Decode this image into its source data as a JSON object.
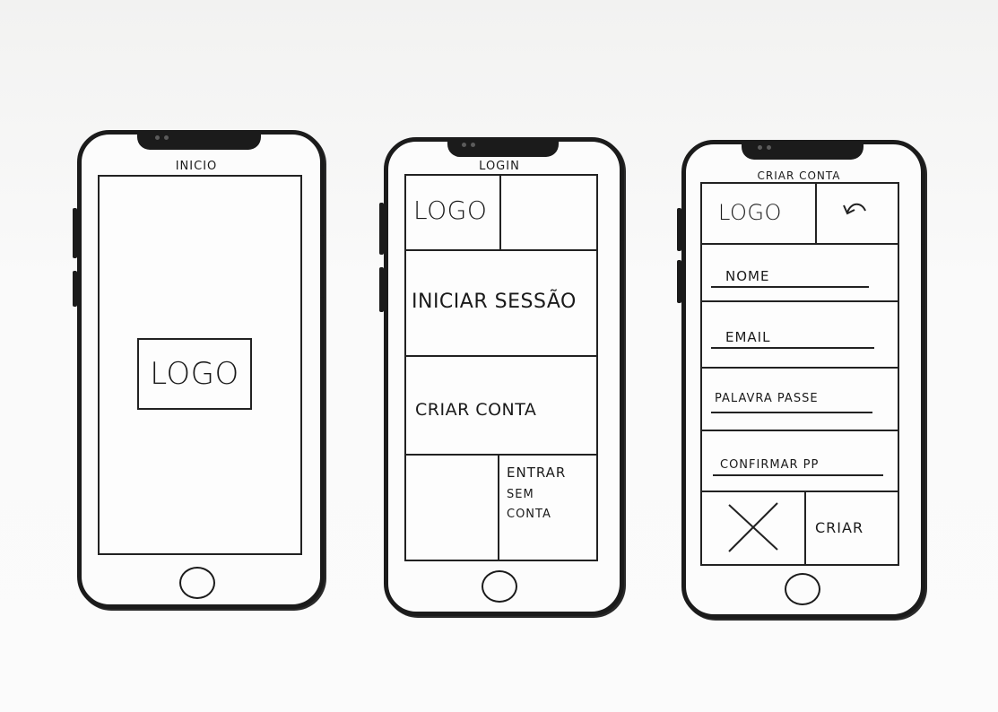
{
  "screens": {
    "inicio": {
      "title": "INICIO",
      "logo": "LOGO"
    },
    "login": {
      "title": "LOGIN",
      "logo": "LOGO",
      "sign_in": "INICIAR SESSÃO",
      "create_account": "CRIAR CONTA",
      "guest_line1": "ENTRAR",
      "guest_line2": "SEM",
      "guest_line3": "CONTA"
    },
    "criar_conta": {
      "title": "CRIAR CONTA",
      "logo": "LOGO",
      "back_icon": "undo-arrow-icon",
      "field_name": "NOME",
      "field_email": "EMAIL",
      "field_password": "PALAVRA PASSE",
      "field_confirm": "CONFIRMAR PP",
      "cancel_icon": "x-icon",
      "submit": "CRIAR"
    }
  },
  "colors": {
    "ink": "#1b1b1b",
    "paper": "#f7f7f6"
  }
}
